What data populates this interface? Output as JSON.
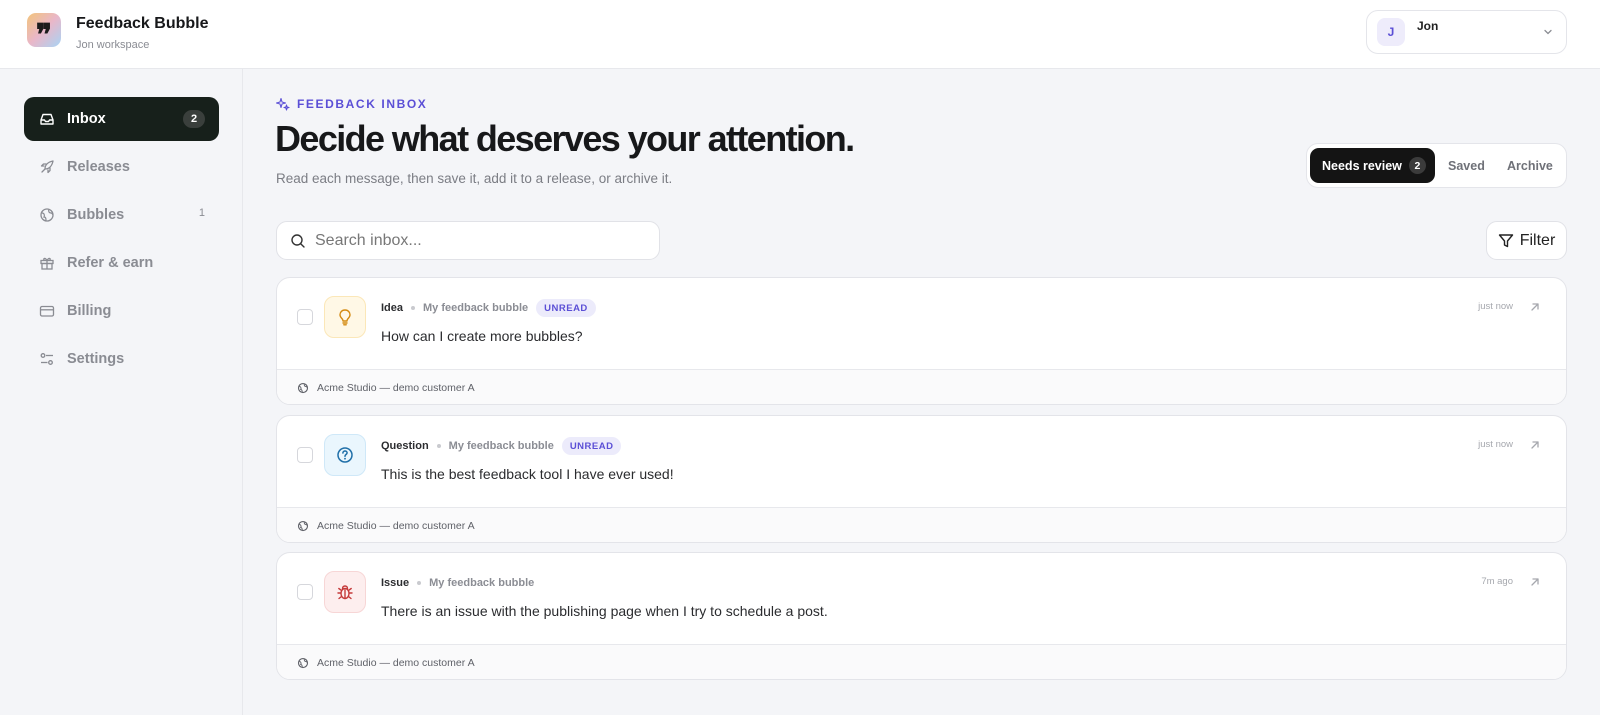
{
  "header": {
    "app_name": "Feedback Bubble",
    "workspace": "Jon workspace",
    "logo_glyph": "❞",
    "user": {
      "initial": "J",
      "name": "Jon"
    }
  },
  "sidebar": {
    "items": [
      {
        "label": "Inbox",
        "icon": "inbox-icon",
        "badge": "2",
        "active": true
      },
      {
        "label": "Releases",
        "icon": "rocket-icon"
      },
      {
        "label": "Bubbles",
        "icon": "globe-icon",
        "count": "1"
      },
      {
        "label": "Refer & earn",
        "icon": "gift-icon"
      },
      {
        "label": "Billing",
        "icon": "credit-card-icon"
      },
      {
        "label": "Settings",
        "icon": "sliders-icon"
      }
    ]
  },
  "main": {
    "eyebrow": "FEEDBACK INBOX",
    "headline": "Decide what deserves your attention.",
    "subline": "Read each message, then save it, add it to a release, or archive it.",
    "tabs": [
      {
        "label": "Needs review",
        "badge": "2",
        "active": true
      },
      {
        "label": "Saved"
      },
      {
        "label": "Archive"
      }
    ],
    "search": {
      "placeholder": "Search inbox...",
      "value": ""
    },
    "filter_label": "Filter"
  },
  "cards": [
    {
      "type": "Idea",
      "icon": "lightbulb-icon",
      "bubble": "My feedback bubble",
      "unread": "UNREAD",
      "message": "How can I create more bubbles?",
      "time": "just now",
      "customer": "Acme Studio — demo customer A"
    },
    {
      "type": "Question",
      "icon": "question-circle-icon",
      "bubble": "My feedback bubble",
      "unread": "UNREAD",
      "message": "This is the best feedback tool I have ever used!",
      "time": "just now",
      "customer": "Acme Studio — demo customer A"
    },
    {
      "type": "Issue",
      "icon": "bug-icon",
      "bubble": "My feedback bubble",
      "message": "There is an issue with the publishing page when I try to schedule a post.",
      "time": "7m ago",
      "customer": "Acme Studio — demo customer A"
    }
  ],
  "colors": {
    "accent": "#5b4fd6",
    "active_nav": "#17201b",
    "idea_bg": "#fff8e6",
    "idea_fg": "#d48a10",
    "question_bg": "#eaf6fd",
    "question_fg": "#1f6fa8",
    "issue_bg": "#fdeeee",
    "issue_fg": "#c53a3a"
  }
}
